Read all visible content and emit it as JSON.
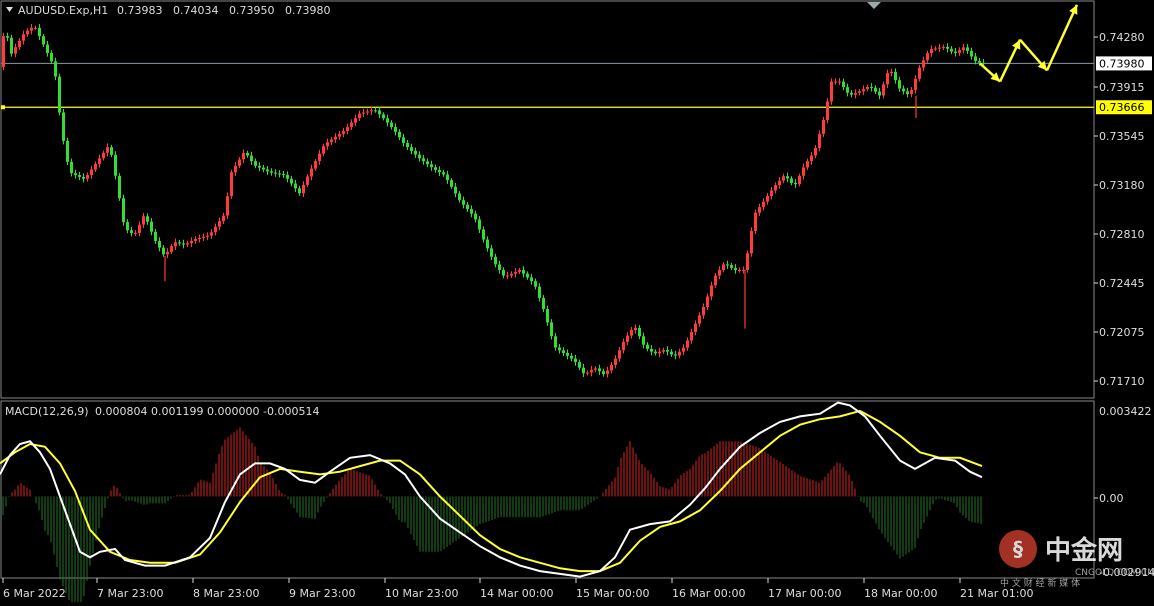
{
  "symbol_line": {
    "symbol": "AUDUSD.Exp,H1",
    "open": "0.73983",
    "high": "0.74034",
    "low": "0.73950",
    "close": "0.73980"
  },
  "indicator_line": {
    "name": "MACD(12,26,9)",
    "values": [
      "0.000804",
      "0.001199",
      "0.000000",
      "-0.000514"
    ]
  },
  "price_axis": {
    "ticks": [
      "0.74280",
      "0.73915",
      "0.73545",
      "0.73180",
      "0.72810",
      "0.72445",
      "0.72075",
      "0.71710"
    ],
    "current_label": "0.73980",
    "level_label": "0.73666"
  },
  "macd_axis": {
    "ticks": [
      "0.003422",
      "0.00",
      "-0.002914"
    ]
  },
  "time_axis": {
    "labels": [
      "6 Mar 2022",
      "7 Mar 23:00",
      "8 Mar 23:00",
      "9 Mar 23:00",
      "10 Mar 23:00",
      "14 Mar 00:00",
      "15 Mar 00:00",
      "16 Mar 00:00",
      "17 Mar 00:00",
      "18 Mar 00:00",
      "21 Mar 01:00"
    ]
  },
  "watermark": {
    "brand": "中金网",
    "sub": "CNGOLD.COM.CN",
    "tagline": "中 文 财 经 新 媒 体"
  },
  "colors": {
    "background": "#000000",
    "bull_candle": "#ff3b3b",
    "bear_candle": "#33dd33",
    "macd_line": "#ffffff",
    "signal_line": "#ffff33",
    "histogram_pos": "#dd2222",
    "histogram_neg": "#227722",
    "grid": "#ffffff",
    "level_line": "#ffff00",
    "forecast_arrow": "#ffff33"
  },
  "chart_data": {
    "type": "candlestick",
    "ylim": [
      0.7159,
      0.7442
    ],
    "hline_current": 0.7398,
    "hline_level": 0.73666,
    "price_path": [
      [
        0,
        0.7388
      ],
      [
        5,
        0.7425
      ],
      [
        12,
        0.7405
      ],
      [
        25,
        0.742
      ],
      [
        35,
        0.7425
      ],
      [
        45,
        0.741
      ],
      [
        55,
        0.7395
      ],
      [
        62,
        0.735
      ],
      [
        70,
        0.732
      ],
      [
        85,
        0.7315
      ],
      [
        95,
        0.7325
      ],
      [
        110,
        0.734
      ],
      [
        118,
        0.731
      ],
      [
        125,
        0.728
      ],
      [
        135,
        0.7275
      ],
      [
        145,
        0.729
      ],
      [
        155,
        0.7272
      ],
      [
        165,
        0.726
      ],
      [
        175,
        0.727
      ],
      [
        185,
        0.7268
      ],
      [
        195,
        0.7272
      ],
      [
        210,
        0.7275
      ],
      [
        225,
        0.729
      ],
      [
        232,
        0.732
      ],
      [
        245,
        0.7335
      ],
      [
        255,
        0.7325
      ],
      [
        270,
        0.732
      ],
      [
        285,
        0.7318
      ],
      [
        300,
        0.7305
      ],
      [
        310,
        0.732
      ],
      [
        325,
        0.734
      ],
      [
        345,
        0.735
      ],
      [
        360,
        0.7362
      ],
      [
        375,
        0.7365
      ],
      [
        385,
        0.7358
      ],
      [
        395,
        0.735
      ],
      [
        405,
        0.734
      ],
      [
        420,
        0.733
      ],
      [
        435,
        0.7322
      ],
      [
        445,
        0.7318
      ],
      [
        460,
        0.73
      ],
      [
        475,
        0.7288
      ],
      [
        485,
        0.727
      ],
      [
        495,
        0.7255
      ],
      [
        505,
        0.7245
      ],
      [
        520,
        0.725
      ],
      [
        535,
        0.724
      ],
      [
        545,
        0.722
      ],
      [
        555,
        0.7195
      ],
      [
        565,
        0.719
      ],
      [
        575,
        0.7185
      ],
      [
        585,
        0.7175
      ],
      [
        595,
        0.718
      ],
      [
        605,
        0.7175
      ],
      [
        615,
        0.7185
      ],
      [
        625,
        0.72
      ],
      [
        635,
        0.721
      ],
      [
        645,
        0.7195
      ],
      [
        655,
        0.719
      ],
      [
        665,
        0.7193
      ],
      [
        675,
        0.7188
      ],
      [
        685,
        0.7195
      ],
      [
        695,
        0.721
      ],
      [
        705,
        0.7225
      ],
      [
        715,
        0.7245
      ],
      [
        725,
        0.7255
      ],
      [
        735,
        0.725
      ],
      [
        745,
        0.725
      ],
      [
        755,
        0.729
      ],
      [
        765,
        0.73
      ],
      [
        775,
        0.731
      ],
      [
        785,
        0.7318
      ],
      [
        795,
        0.731
      ],
      [
        805,
        0.7325
      ],
      [
        815,
        0.7335
      ],
      [
        825,
        0.736
      ],
      [
        832,
        0.7385
      ],
      [
        840,
        0.7385
      ],
      [
        850,
        0.7375
      ],
      [
        860,
        0.7378
      ],
      [
        870,
        0.7382
      ],
      [
        880,
        0.7375
      ],
      [
        890,
        0.7395
      ],
      [
        900,
        0.738
      ],
      [
        910,
        0.7375
      ],
      [
        920,
        0.7395
      ],
      [
        930,
        0.7408
      ],
      [
        945,
        0.741
      ],
      [
        955,
        0.7405
      ],
      [
        965,
        0.741
      ],
      [
        975,
        0.74
      ],
      [
        982,
        0.7398
      ]
    ],
    "macd_ylim": [
      -0.002914,
      0.003422
    ],
    "macd_path": [
      [
        0,
        0.0008
      ],
      [
        10,
        0.0015
      ],
      [
        20,
        0.0019
      ],
      [
        30,
        0.002
      ],
      [
        40,
        0.0016
      ],
      [
        50,
        0.001
      ],
      [
        60,
        0.0
      ],
      [
        70,
        -0.001
      ],
      [
        80,
        -0.002
      ],
      [
        90,
        -0.0022
      ],
      [
        100,
        -0.002
      ],
      [
        115,
        -0.0019
      ],
      [
        125,
        -0.0023
      ],
      [
        145,
        -0.0025
      ],
      [
        165,
        -0.0025
      ],
      [
        190,
        -0.0022
      ],
      [
        210,
        -0.0015
      ],
      [
        225,
        -0.0002
      ],
      [
        240,
        0.0008
      ],
      [
        255,
        0.0012
      ],
      [
        270,
        0.0012
      ],
      [
        285,
        0.001
      ],
      [
        300,
        0.0006
      ],
      [
        315,
        0.0005
      ],
      [
        330,
        0.0009
      ],
      [
        350,
        0.0014
      ],
      [
        370,
        0.0015
      ],
      [
        390,
        0.0012
      ],
      [
        405,
        0.0008
      ],
      [
        420,
        0.0
      ],
      [
        440,
        -0.0008
      ],
      [
        460,
        -0.0013
      ],
      [
        480,
        -0.0018
      ],
      [
        500,
        -0.0022
      ],
      [
        520,
        -0.0025
      ],
      [
        540,
        -0.0027
      ],
      [
        560,
        -0.0028
      ],
      [
        580,
        -0.0029
      ],
      [
        600,
        -0.0027
      ],
      [
        615,
        -0.0022
      ],
      [
        630,
        -0.0012
      ],
      [
        650,
        -0.001
      ],
      [
        670,
        -0.0009
      ],
      [
        690,
        -0.0003
      ],
      [
        705,
        0.0003
      ],
      [
        720,
        0.001
      ],
      [
        740,
        0.0018
      ],
      [
        760,
        0.0023
      ],
      [
        780,
        0.0027
      ],
      [
        800,
        0.0029
      ],
      [
        820,
        0.003
      ],
      [
        838,
        0.0034
      ],
      [
        850,
        0.0033
      ],
      [
        865,
        0.0029
      ],
      [
        880,
        0.0022
      ],
      [
        900,
        0.0013
      ],
      [
        915,
        0.001
      ],
      [
        935,
        0.0014
      ],
      [
        955,
        0.0013
      ],
      [
        970,
        0.0009
      ],
      [
        982,
        0.0007
      ]
    ],
    "signal_path": [
      [
        0,
        0.0012
      ],
      [
        15,
        0.0016
      ],
      [
        30,
        0.0019
      ],
      [
        45,
        0.0018
      ],
      [
        60,
        0.0012
      ],
      [
        75,
        0.0002
      ],
      [
        90,
        -0.0012
      ],
      [
        110,
        -0.002
      ],
      [
        130,
        -0.0023
      ],
      [
        150,
        -0.0024
      ],
      [
        175,
        -0.0024
      ],
      [
        200,
        -0.0021
      ],
      [
        220,
        -0.0013
      ],
      [
        240,
        -0.0002
      ],
      [
        260,
        0.0007
      ],
      [
        280,
        0.001
      ],
      [
        300,
        0.0009
      ],
      [
        320,
        0.0008
      ],
      [
        340,
        0.0009
      ],
      [
        360,
        0.0011
      ],
      [
        380,
        0.0013
      ],
      [
        400,
        0.0013
      ],
      [
        420,
        0.0008
      ],
      [
        440,
        0.0
      ],
      [
        460,
        -0.0007
      ],
      [
        480,
        -0.0014
      ],
      [
        500,
        -0.0019
      ],
      [
        520,
        -0.0022
      ],
      [
        540,
        -0.0024
      ],
      [
        560,
        -0.0026
      ],
      [
        580,
        -0.0027
      ],
      [
        600,
        -0.0027
      ],
      [
        620,
        -0.0024
      ],
      [
        640,
        -0.0016
      ],
      [
        660,
        -0.0011
      ],
      [
        680,
        -0.0009
      ],
      [
        700,
        -0.0005
      ],
      [
        720,
        0.0002
      ],
      [
        740,
        0.001
      ],
      [
        760,
        0.0016
      ],
      [
        780,
        0.0022
      ],
      [
        800,
        0.0026
      ],
      [
        820,
        0.0028
      ],
      [
        840,
        0.0029
      ],
      [
        860,
        0.0031
      ],
      [
        880,
        0.0027
      ],
      [
        900,
        0.0022
      ],
      [
        920,
        0.0016
      ],
      [
        940,
        0.0014
      ],
      [
        960,
        0.0014
      ],
      [
        982,
        0.0011
      ]
    ],
    "forecast_arrow": [
      [
        [
          980,
          0.7398
        ],
        [
          1000,
          0.7385
        ]
      ],
      [
        [
          1000,
          0.7385
        ],
        [
          1020,
          0.7415
        ]
      ],
      [
        [
          1020,
          0.7415
        ],
        [
          1047,
          0.7393
        ]
      ],
      [
        [
          1047,
          0.7393
        ],
        [
          1077,
          0.744
        ]
      ]
    ],
    "price_spikes": [
      [
        [
          165,
          0.726
        ],
        [
          165,
          0.7242
        ]
      ],
      [
        [
          745,
          0.725
        ],
        [
          745,
          0.7208
        ]
      ],
      [
        [
          916,
          0.7375
        ],
        [
          916,
          0.7359
        ]
      ]
    ]
  }
}
